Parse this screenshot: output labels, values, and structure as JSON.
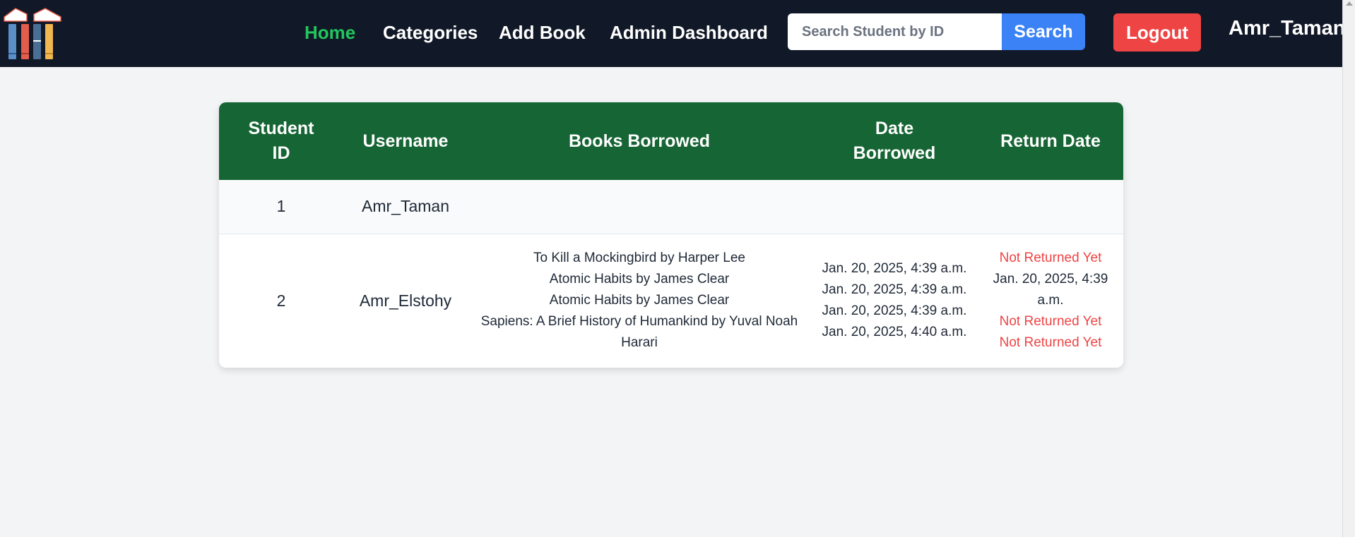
{
  "nav": {
    "links": [
      "Home",
      "Categories",
      "Add Book",
      "Admin Dashboard"
    ],
    "active_color": "#22c55e"
  },
  "search": {
    "placeholder": "Search Student by ID",
    "button_label": "Search"
  },
  "logout_label": "Logout",
  "current_user": "Amr_Taman",
  "table": {
    "headers": [
      "Student ID",
      "Username",
      "Books Borrowed",
      "Date Borrowed",
      "Return Date"
    ],
    "rows": [
      {
        "student_id": "1",
        "username": "Amr_Taman",
        "books": [],
        "dates_borrowed": [],
        "return_dates": []
      },
      {
        "student_id": "2",
        "username": "Amr_Elstohy",
        "books": [
          "To Kill a Mockingbird by Harper Lee",
          "Atomic Habits by James Clear",
          "Atomic Habits by James Clear",
          "Sapiens: A Brief History of Humankind by Yuval Noah Harari"
        ],
        "dates_borrowed": [
          "Jan. 20, 2025, 4:39 a.m.",
          "Jan. 20, 2025, 4:39 a.m.",
          "Jan. 20, 2025, 4:39 a.m.",
          "Jan. 20, 2025, 4:40 a.m."
        ],
        "return_dates": [
          "Not Returned Yet",
          "Jan. 20, 2025, 4:39 a.m.",
          "Not Returned Yet",
          "Not Returned Yet"
        ]
      }
    ]
  },
  "colors": {
    "navbar_bg": "#111827",
    "table_header_bg": "#166534",
    "search_button": "#3b82f6",
    "logout_button": "#ef4444",
    "not_returned": "#ef4444"
  },
  "icons": {
    "logo": "books-logo-icon"
  }
}
